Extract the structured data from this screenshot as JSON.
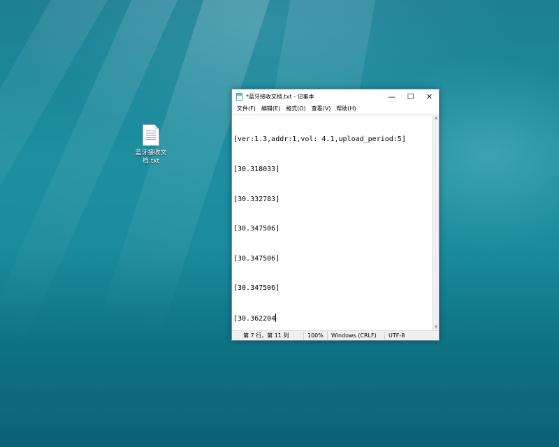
{
  "desktop": {
    "icons": [
      {
        "label": "蓝牙接收文档.txt",
        "icon": "text-file-icon"
      }
    ]
  },
  "window": {
    "title": "*蓝牙接收文档.txt - 记事本",
    "controls": {
      "minimize": "—",
      "maximize": "☐",
      "close": "✕"
    },
    "menu": [
      "文件(F)",
      "编辑(E)",
      "格式(O)",
      "查看(V)",
      "帮助(H)"
    ],
    "content_lines": [
      "[ver:1.3,addr:1,vol: 4.1,upload_period:5]",
      "[30.318033]",
      "[30.332783]",
      "[30.347506]",
      "[30.347506]",
      "[30.347506]",
      "[30.362204"
    ],
    "status": {
      "position": "第 7 行，第 11 列",
      "zoom": "100%",
      "line_ending": "Windows (CRLF)",
      "encoding": "UTF-8"
    }
  }
}
